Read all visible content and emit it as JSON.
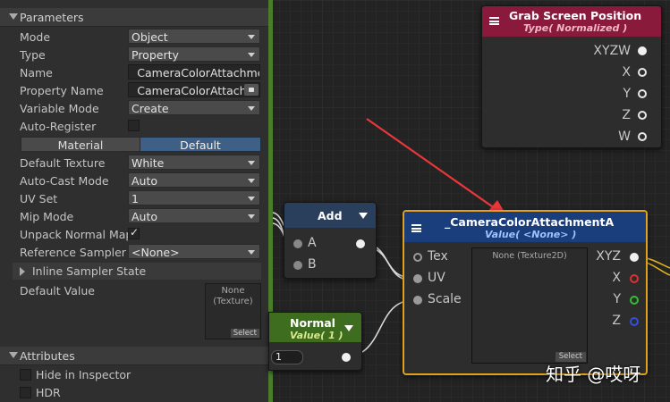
{
  "panel": {
    "section_parameters": "Parameters",
    "mode": {
      "label": "Mode",
      "value": "Object"
    },
    "type": {
      "label": "Type",
      "value": "Property"
    },
    "name": {
      "label": "Name",
      "value": "_CameraColorAttachment"
    },
    "property_name": {
      "label": "Property Name",
      "value": "_CameraColorAttachr"
    },
    "variable_mode": {
      "label": "Variable Mode",
      "value": "Create"
    },
    "auto_register": {
      "label": "Auto-Register"
    },
    "toggle": {
      "material": "Material",
      "default": "Default",
      "selected": "Default"
    },
    "default_texture": {
      "label": "Default Texture",
      "value": "White"
    },
    "auto_cast": {
      "label": "Auto-Cast Mode",
      "value": "Auto"
    },
    "uv_set": {
      "label": "UV Set",
      "value": "1"
    },
    "mip_mode": {
      "label": "Mip Mode",
      "value": "Auto"
    },
    "unpack_normal": {
      "label": "Unpack Normal Map",
      "checked": true
    },
    "ref_sampler": {
      "label": "Reference Sampler",
      "value": "<None>"
    },
    "inline_sampler": "Inline Sampler State",
    "default_value": {
      "label": "Default Value",
      "tex_l1": "None",
      "tex_l2": "(Texture)",
      "select": "Select"
    },
    "section_attributes": "Attributes",
    "hide_in_inspector": "Hide in Inspector",
    "hdr": "HDR"
  },
  "nodes": {
    "grab": {
      "title": "Grab Screen Position",
      "subtitle": "Type( Normalized )",
      "color": "#8a1a3c",
      "outputs": [
        "XYZW",
        "X",
        "Y",
        "Z",
        "W"
      ]
    },
    "add": {
      "title": "Add",
      "inputs": [
        "A",
        "B"
      ]
    },
    "normal": {
      "title": "Normal",
      "subtitle": "Value( 1 )",
      "value": "1",
      "color": "#3f6d20"
    },
    "sampler": {
      "title": "_CameraColorAttachmentA",
      "subtitle": "Value( <None> )",
      "color": "#1a3d7c",
      "selection_color": "#e0a020",
      "inputs": [
        "Tex",
        "UV",
        "Scale"
      ],
      "preview_l1": "None (Texture2D)",
      "select": "Select",
      "outputs": [
        "XYZ",
        "X",
        "Y",
        "Z"
      ]
    }
  },
  "watermark": "知乎 @哎呀"
}
